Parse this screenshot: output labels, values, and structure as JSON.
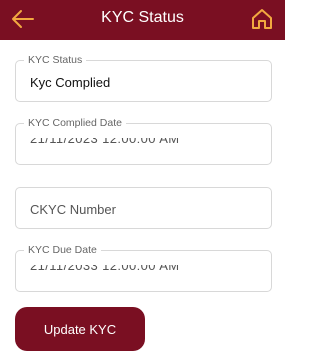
{
  "appbar": {
    "title": "KYC Status",
    "back_icon": "arrow-left-icon",
    "home_icon": "home-icon"
  },
  "fields": {
    "kyc_status": {
      "label": "KYC Status",
      "value": "Kyc Complied"
    },
    "kyc_complied_date": {
      "label": "KYC Complied Date",
      "value": "21/11/2023 12:00:00 AM"
    },
    "ckyc_number": {
      "placeholder": "CKYC Number"
    },
    "kyc_due_date": {
      "label": "KYC Due Date",
      "value": "21/11/2033 12:00:00 AM"
    }
  },
  "actions": {
    "update_label": "Update KYC"
  },
  "colors": {
    "primary": "#7a0f22",
    "icon_accent": "#f2a940"
  }
}
